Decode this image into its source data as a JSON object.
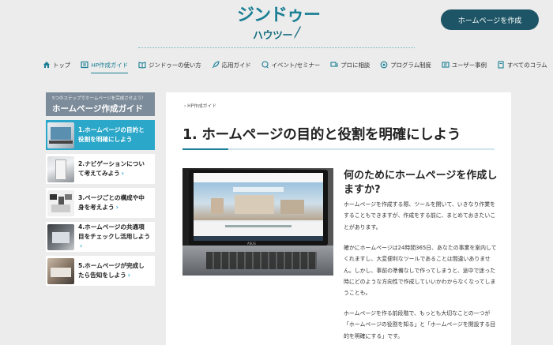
{
  "header": {
    "logo_line1": "ジンドゥー",
    "logo_line2": "ハウツー",
    "cta_button": "ホームページを作成"
  },
  "nav": [
    {
      "label": "トップ",
      "icon": "home-icon"
    },
    {
      "label": "HP作成ガイド",
      "icon": "guide-icon",
      "active": true
    },
    {
      "label": "ジンドゥーの使い方",
      "icon": "book-icon"
    },
    {
      "label": "応用ガイド",
      "icon": "rocket-icon"
    },
    {
      "label": "イベント/セミナー",
      "icon": "chat-icon"
    },
    {
      "label": "プロに相談",
      "icon": "consult-icon"
    },
    {
      "label": "プログラム制度",
      "icon": "program-icon"
    },
    {
      "label": "ユーザー事例",
      "icon": "user-case-icon"
    },
    {
      "label": "すべてのコラム",
      "icon": "column-icon"
    }
  ],
  "sidebar": {
    "subtitle": "5つのステップでホームページを完成させよう！",
    "title": "ホームページ作成ガイド",
    "steps": [
      {
        "line1": "1.ホームページの目的と",
        "line2": "役割を明確にしよう",
        "active": true
      },
      {
        "line1": "2.ナビゲーションについ",
        "line2": "て考えてみよう"
      },
      {
        "line1": "3.ページごとの構成や中",
        "line2": "身を考えよう"
      },
      {
        "line1": "4.ホームページの共通項",
        "line2": "目をチェックし活用しよう"
      },
      {
        "line1": "5.ホームページが完成し",
        "line2": "たら告知をしよう"
      }
    ]
  },
  "main": {
    "breadcrumb": "HP作成ガイド",
    "title": "1. ホームページの目的と役割を明確にしよう",
    "h2": "何のためにホームページを作成しますか?",
    "p1": "ホームページを作成する際、ツールを開いて、いきなり作業をすることもできますが、作成をする前に、まとめておきたいことがあります。",
    "p2": "確かにホームページは24時間365日、あなたの事業を案内してくれますし、大変便利なツールであることは間違いありません。しかし、事前の準備なしで作ってしまうと、途中で迷った時にどのような方向性で作成していいかわからなくなってしまうことも。",
    "p3": "ホームページを作る前段階で、もっとも大切なことの一つが「ホームページの役割を知る」と「ホームページを開設する目的を明確にする」です。",
    "laptop_brand": "ASUS"
  },
  "colors": {
    "accent": "#1b7f95",
    "active_step": "#2ba7c9",
    "cta_bg": "#1e5566",
    "sidebar_head": "#7d8c9a"
  }
}
